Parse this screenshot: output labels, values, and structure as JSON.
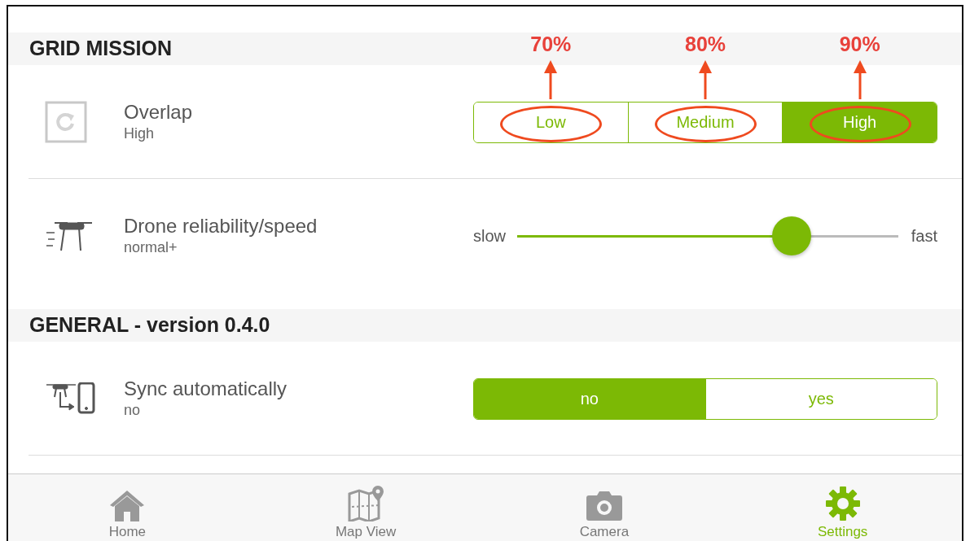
{
  "sections": [
    {
      "title": "GRID MISSION",
      "settings": [
        {
          "kind": "segmented",
          "title": "Overlap",
          "value": "High",
          "options": [
            {
              "label": "Low",
              "selected": false,
              "annotation": "70%"
            },
            {
              "label": "Medium",
              "selected": false,
              "annotation": "80%"
            },
            {
              "label": "High",
              "selected": true,
              "annotation": "90%"
            }
          ]
        },
        {
          "kind": "slider",
          "title": "Drone reliability/speed",
          "value": "normal+",
          "min_label": "slow",
          "max_label": "fast",
          "level": 0.72
        }
      ]
    },
    {
      "title": "GENERAL - version 0.4.0",
      "settings": [
        {
          "kind": "segmented",
          "title": "Sync automatically",
          "value": "no",
          "options": [
            {
              "label": "no",
              "selected": true
            },
            {
              "label": "yes",
              "selected": false
            }
          ]
        }
      ]
    }
  ],
  "tab_bar": [
    {
      "label": "Home",
      "selected": false
    },
    {
      "label": "Map View",
      "selected": false
    },
    {
      "label": "Camera",
      "selected": false
    },
    {
      "label": "Settings",
      "selected": true
    }
  ]
}
